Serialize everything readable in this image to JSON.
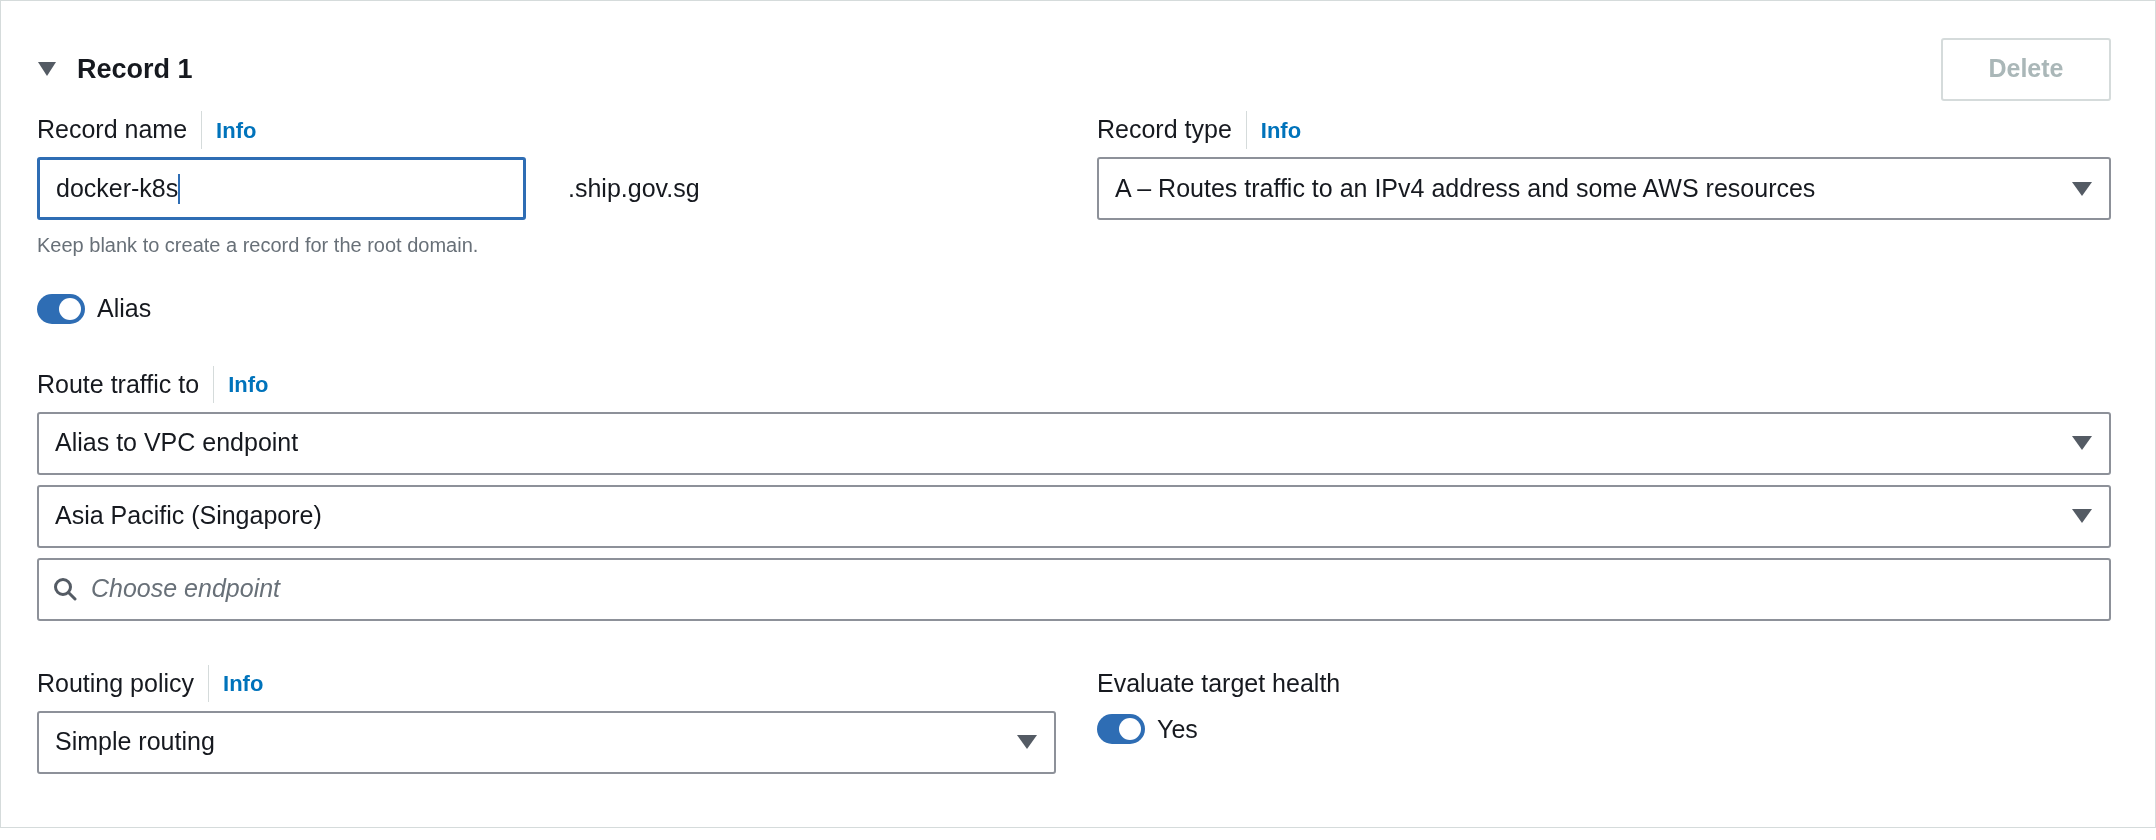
{
  "record": {
    "title": "Record 1",
    "expanded": true,
    "delete_button": {
      "label": "Delete",
      "disabled": true
    }
  },
  "record_name": {
    "label": "Record name",
    "info": "Info",
    "value": "docker-k8s",
    "focused": true,
    "suffix": ".ship.gov.sg",
    "hint": "Keep blank to create a record for the root domain."
  },
  "record_type": {
    "label": "Record type",
    "info": "Info",
    "value": "A – Routes traffic to an IPv4 address and some AWS resources"
  },
  "alias": {
    "label": "Alias",
    "on": true
  },
  "route_traffic_to": {
    "label": "Route traffic to",
    "info": "Info",
    "fields": [
      {
        "kind": "select",
        "value": "Alias to VPC endpoint"
      },
      {
        "kind": "select",
        "value": "Asia Pacific (Singapore)"
      },
      {
        "kind": "search",
        "placeholder": "Choose endpoint"
      }
    ]
  },
  "routing_policy": {
    "label": "Routing policy",
    "info": "Info",
    "value": "Simple routing"
  },
  "evaluate_target_health": {
    "label": "Evaluate target health",
    "toggle_label": "Yes",
    "on": true
  }
}
